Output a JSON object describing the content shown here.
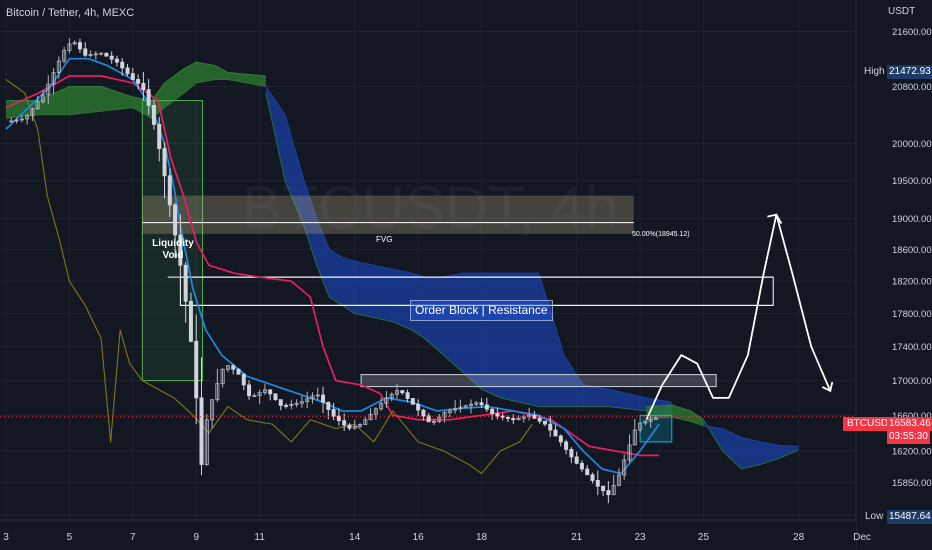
{
  "header": {
    "title": "Bitcoin / Tether, 4h, MEXC",
    "currency": "USDT"
  },
  "chart_data": {
    "type": "candlestick",
    "y_scale": "log",
    "ylim": [
      15450,
      21800
    ],
    "xlim": [
      3,
      30
    ],
    "y_ticks": [
      "21600.00",
      "20800.00",
      "20000.00",
      "19500.00",
      "19000.00",
      "18600.00",
      "18200.00",
      "17800.00",
      "17400.00",
      "17000.00",
      "16600.00",
      "16200.00",
      "15850.00",
      "15500.00"
    ],
    "x_ticks": [
      {
        "x": 3,
        "label": "3"
      },
      {
        "x": 5,
        "label": "5"
      },
      {
        "x": 7,
        "label": "7"
      },
      {
        "x": 9,
        "label": "9"
      },
      {
        "x": 11,
        "label": "11"
      },
      {
        "x": 14,
        "label": "14"
      },
      {
        "x": 16,
        "label": "16"
      },
      {
        "x": 18,
        "label": "18"
      },
      {
        "x": 21,
        "label": "21"
      },
      {
        "x": 23,
        "label": "23"
      },
      {
        "x": 25,
        "label": "25"
      },
      {
        "x": 28,
        "label": "28"
      },
      {
        "x": 30,
        "label": "Dec"
      }
    ],
    "price_path": [
      [
        3,
        20300
      ],
      [
        3.6,
        20350
      ],
      [
        4.2,
        20700
      ],
      [
        4.8,
        21300
      ],
      [
        5.1,
        21472.93
      ],
      [
        5.5,
        21250
      ],
      [
        6.0,
        21280
      ],
      [
        6.5,
        21150
      ],
      [
        7.0,
        20900
      ],
      [
        7.3,
        20800
      ],
      [
        7.6,
        20400
      ],
      [
        7.9,
        19800
      ],
      [
        8.2,
        19100
      ],
      [
        8.5,
        18400
      ],
      [
        8.8,
        17600
      ],
      [
        9.0,
        16800
      ],
      [
        9.15,
        16000
      ],
      [
        9.35,
        16600
      ],
      [
        9.6,
        16900
      ],
      [
        9.9,
        17200
      ],
      [
        10.3,
        17100
      ],
      [
        10.7,
        16800
      ],
      [
        11.2,
        16900
      ],
      [
        11.7,
        16700
      ],
      [
        12.3,
        16750
      ],
      [
        12.8,
        16850
      ],
      [
        13.3,
        16600
      ],
      [
        13.8,
        16450
      ],
      [
        14.2,
        16500
      ],
      [
        14.6,
        16650
      ],
      [
        15.0,
        16800
      ],
      [
        15.4,
        16900
      ],
      [
        15.9,
        16700
      ],
      [
        16.4,
        16500
      ],
      [
        16.9,
        16650
      ],
      [
        17.4,
        16700
      ],
      [
        17.9,
        16750
      ],
      [
        18.4,
        16600
      ],
      [
        19.0,
        16550
      ],
      [
        19.5,
        16600
      ],
      [
        20.0,
        16500
      ],
      [
        20.5,
        16300
      ],
      [
        20.9,
        16100
      ],
      [
        21.3,
        15950
      ],
      [
        21.7,
        15800
      ],
      [
        22.0,
        15720
      ],
      [
        22.3,
        15900
      ],
      [
        22.6,
        16200
      ],
      [
        22.9,
        16500
      ],
      [
        23.3,
        16550
      ],
      [
        23.6,
        16583.46
      ]
    ],
    "tenkan": [
      [
        3,
        20200
      ],
      [
        4.4,
        20800
      ],
      [
        5.0,
        21200
      ],
      [
        5.6,
        21200
      ],
      [
        6.2,
        21100
      ],
      [
        7.0,
        20900
      ],
      [
        7.6,
        20500
      ],
      [
        8.0,
        20000
      ],
      [
        8.3,
        19400
      ],
      [
        8.6,
        18700
      ],
      [
        8.9,
        18100
      ],
      [
        9.3,
        17600
      ],
      [
        9.8,
        17300
      ],
      [
        10.6,
        17050
      ],
      [
        11.4,
        16950
      ],
      [
        12.2,
        16850
      ],
      [
        13.0,
        16750
      ],
      [
        13.6,
        16650
      ],
      [
        14.2,
        16650
      ],
      [
        15.0,
        16800
      ],
      [
        15.8,
        16750
      ],
      [
        16.6,
        16650
      ],
      [
        17.4,
        16680
      ],
      [
        18.2,
        16700
      ],
      [
        19.0,
        16650
      ],
      [
        19.8,
        16600
      ],
      [
        20.6,
        16450
      ],
      [
        21.2,
        16200
      ],
      [
        21.8,
        16000
      ],
      [
        22.4,
        15950
      ],
      [
        23.0,
        16200
      ],
      [
        23.6,
        16500
      ]
    ],
    "kijun": [
      [
        3,
        20500
      ],
      [
        4.0,
        20700
      ],
      [
        5.0,
        20950
      ],
      [
        6.0,
        20950
      ],
      [
        7.0,
        20850
      ],
      [
        7.8,
        20600
      ],
      [
        8.2,
        19800
      ],
      [
        8.6,
        19300
      ],
      [
        9.0,
        18700
      ],
      [
        9.4,
        18400
      ],
      [
        10.2,
        18300
      ],
      [
        11.0,
        18250
      ],
      [
        12.0,
        18200
      ],
      [
        12.6,
        18000
      ],
      [
        13.0,
        17400
      ],
      [
        13.4,
        17000
      ],
      [
        14.2,
        16950
      ],
      [
        14.8,
        16850
      ],
      [
        15.2,
        16600
      ],
      [
        16.0,
        16550
      ],
      [
        17.0,
        16550
      ],
      [
        18.0,
        16600
      ],
      [
        19.0,
        16650
      ],
      [
        19.6,
        16600
      ],
      [
        20.2,
        16550
      ],
      [
        20.8,
        16400
      ],
      [
        21.4,
        16250
      ],
      [
        22.2,
        16200
      ],
      [
        23.0,
        16150
      ],
      [
        23.6,
        16150
      ]
    ],
    "chikou": [
      [
        3,
        20900
      ],
      [
        3.6,
        20700
      ],
      [
        4.0,
        20200
      ],
      [
        4.3,
        19300
      ],
      [
        4.7,
        18700
      ],
      [
        5.0,
        18200
      ],
      [
        5.5,
        17900
      ],
      [
        6.0,
        17500
      ],
      [
        6.3,
        16300
      ],
      [
        6.6,
        17600
      ],
      [
        6.9,
        17200
      ],
      [
        7.3,
        17000
      ],
      [
        7.8,
        16900
      ],
      [
        8.3,
        16800
      ],
      [
        8.9,
        16600
      ],
      [
        9.4,
        16400
      ],
      [
        10.0,
        16700
      ],
      [
        10.6,
        16550
      ],
      [
        11.4,
        16500
      ],
      [
        12.0,
        16300
      ],
      [
        12.6,
        16550
      ],
      [
        13.4,
        16450
      ],
      [
        14.0,
        16500
      ],
      [
        14.6,
        16300
      ],
      [
        15.2,
        16650
      ],
      [
        16.0,
        16300
      ],
      [
        16.8,
        16200
      ],
      [
        17.6,
        16050
      ],
      [
        18.0,
        15950
      ],
      [
        18.6,
        16200
      ],
      [
        19.2,
        16300
      ],
      [
        19.6,
        16500
      ]
    ],
    "cloud_green": [
      [
        3,
        20600,
        20350
      ],
      [
        4.0,
        20600,
        20400
      ],
      [
        5.0,
        20800,
        20400
      ],
      [
        6.0,
        20800,
        20450
      ],
      [
        7.0,
        20650,
        20500
      ],
      [
        7.6,
        20600,
        20350
      ],
      [
        8.0,
        20850,
        20500
      ],
      [
        8.6,
        21050,
        20700
      ],
      [
        9.0,
        21150,
        20850
      ],
      [
        9.6,
        21100,
        20900
      ],
      [
        10.0,
        21000,
        20900
      ],
      [
        11.2,
        20950,
        20800
      ]
    ],
    "cloud_blue": [
      [
        11.2,
        20800,
        20700
      ],
      [
        11.8,
        20400,
        19500
      ],
      [
        12.4,
        19500,
        18900
      ],
      [
        12.8,
        19000,
        18400
      ],
      [
        13.2,
        18600,
        18000
      ],
      [
        13.6,
        18500,
        17900
      ],
      [
        14.0,
        18450,
        17800
      ],
      [
        14.6,
        18400,
        17750
      ],
      [
        15.2,
        18350,
        17700
      ],
      [
        15.8,
        18300,
        17600
      ],
      [
        16.2,
        18250,
        17500
      ],
      [
        16.8,
        18250,
        17300
      ],
      [
        17.4,
        18300,
        17100
      ],
      [
        18.0,
        18300,
        16900
      ],
      [
        18.6,
        18300,
        16800
      ],
      [
        19.2,
        18300,
        16750
      ],
      [
        19.8,
        18300,
        16700
      ],
      [
        20.2,
        17800,
        16700
      ],
      [
        20.6,
        17300,
        16700
      ],
      [
        21.2,
        16950,
        16700
      ],
      [
        22.0,
        16900,
        16700
      ],
      [
        23.2,
        16800,
        16650
      ],
      [
        24.0,
        16750,
        16600
      ]
    ],
    "cloud_green_2": [
      [
        23.2,
        16700,
        16560
      ],
      [
        24.0,
        16720,
        16580
      ],
      [
        24.6,
        16650,
        16530
      ],
      [
        25.0,
        16550,
        16480
      ]
    ],
    "cloud_blue_2": [
      [
        25.0,
        16480,
        16550
      ],
      [
        25.6,
        16450,
        16200
      ],
      [
        26.2,
        16350,
        16000
      ],
      [
        26.8,
        16300,
        16050
      ],
      [
        27.4,
        16260,
        16120
      ],
      [
        28.0,
        16250,
        16210
      ]
    ],
    "zones": [
      {
        "label": "Liquidity Void",
        "x0": 7.3,
        "x1": 9.2,
        "y0": 17000,
        "y1": 20600,
        "color": "#4caf50"
      },
      {
        "label": "FVG",
        "x0": 7.3,
        "x1": 22.8,
        "y0": 18800,
        "y1": 19300,
        "color": "#c8b88a"
      },
      {
        "label": "Order Block | Resistance",
        "x0": 8.5,
        "x1": 27.2,
        "y0": 17900,
        "y1": 18250,
        "color": "#ffffff"
      },
      {
        "label": "",
        "x0": 14.2,
        "x1": 25.4,
        "y0": 16930,
        "y1": 17070,
        "color": "#d1d4dc"
      },
      {
        "label": "",
        "x0": 23.0,
        "x1": 24.0,
        "y0": 16300,
        "y1": 16600,
        "color": "#00bcd4"
      }
    ],
    "fib_label": "50.00%(18945.12)",
    "projection": [
      [
        23.2,
        16550
      ],
      [
        23.7,
        16950
      ],
      [
        24.3,
        17300
      ],
      [
        24.8,
        17200
      ],
      [
        25.3,
        16800
      ],
      [
        25.8,
        16800
      ],
      [
        26.4,
        17300
      ],
      [
        26.9,
        18300
      ],
      [
        27.3,
        19050
      ],
      [
        27.8,
        18300
      ],
      [
        28.4,
        17400
      ],
      [
        29.0,
        16880
      ]
    ],
    "high": {
      "label": "High",
      "value": "21472.93"
    },
    "low": {
      "label": "Low",
      "value": "15487.64"
    },
    "last": {
      "symbol": "BTCUSDT",
      "value": "16583.46",
      "countdown": "03:55:30",
      "y": 16583.46
    },
    "colors": {
      "up": "#b2b5be",
      "down": "#d1d4dc",
      "tenkan": "#1e88e5",
      "kijun": "#e91e63",
      "chikou": "#827717",
      "cloud_green": "#2e7d32",
      "cloud_blue": "#1a3fa3",
      "last_price": "#f23645"
    }
  }
}
